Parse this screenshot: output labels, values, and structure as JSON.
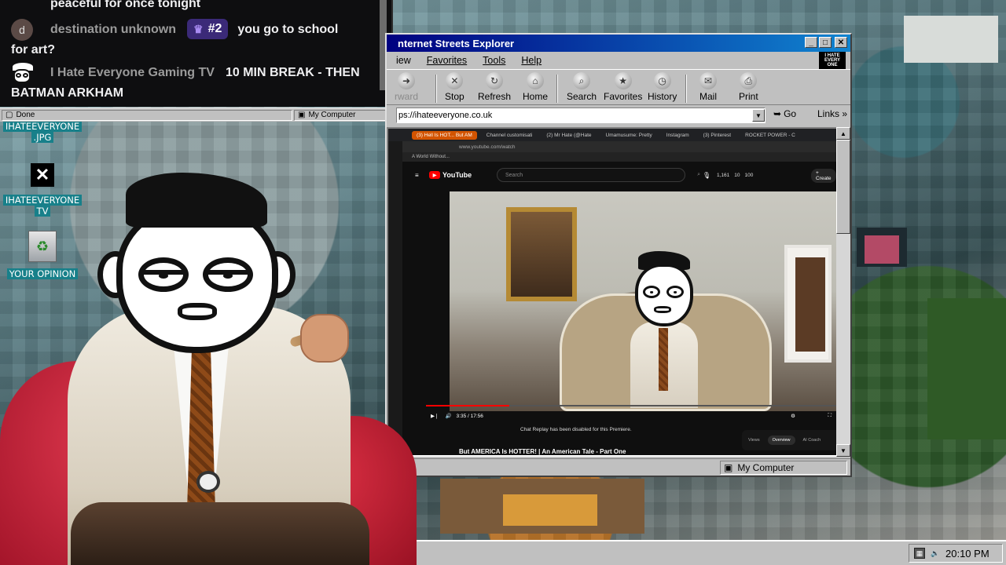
{
  "chat": {
    "partial_line": "peaceful for once tonight",
    "messages": [
      {
        "avatar": "d",
        "user": "destination unknown",
        "badge": "#2",
        "text_1": "you go to school",
        "text_2": "for art?"
      },
      {
        "user": "I Hate Everyone Gaming TV",
        "text_1": "10 MIN BREAK - THEN",
        "text_2": "BATMAN ARKHAM"
      }
    ],
    "status_done": "Done",
    "status_zone": "My Computer"
  },
  "desktop": {
    "icons": [
      {
        "line1": "IHATEEVERYONE",
        "line2": ".JPG"
      },
      {
        "line1": "IHATEEVERYONE",
        "line2": "TV",
        "glyph": "x-logo-icon"
      },
      {
        "line1": "YOUR OPINION",
        "glyph": "recycle-bin-icon"
      }
    ]
  },
  "browser": {
    "title": "nternet Streets Explorer",
    "menu": [
      "iew",
      "Favorites",
      "Tools",
      "Help"
    ],
    "logo_text": "I HATE EVERY ONE",
    "toolbar": [
      {
        "label": "rward",
        "icon": "forward-icon",
        "disabled": true
      },
      {
        "label": "Stop",
        "icon": "stop-icon"
      },
      {
        "label": "Refresh",
        "icon": "refresh-icon"
      },
      {
        "label": "Home",
        "icon": "home-icon"
      },
      {
        "label": "Search",
        "icon": "search-icon"
      },
      {
        "label": "Favorites",
        "icon": "favorites-icon"
      },
      {
        "label": "History",
        "icon": "history-icon"
      },
      {
        "label": "Mail",
        "icon": "mail-icon"
      },
      {
        "label": "Print",
        "icon": "print-icon"
      }
    ],
    "address": "ps://ihateeveryone.co.uk",
    "go": "Go",
    "links": "Links",
    "status_zone": "My Computer"
  },
  "inner": {
    "tabs": [
      "(3) Hell Is HOT... But AM",
      "Channel customisati",
      "(2) Mr Hate (@Hate",
      "Umamusume: Pretty",
      "Instagram",
      "(3) Pinterest",
      "ROCKET POWER - C"
    ],
    "url": "www.youtube.com/watch",
    "bookmark": "A World Without...",
    "youtube": {
      "logo": "YouTube",
      "search_placeholder": "Search",
      "stats": [
        "1,161",
        "10",
        "100"
      ],
      "create": "Create",
      "time": "3:35 / 17:56",
      "progress": 0.2,
      "chat_replay": "Chat Replay has been disabled for this Premiere.",
      "video_title": "But AMERICA Is HOTTER! | An American Tale - Part One",
      "panel_tabs": [
        "Views",
        "Overview",
        "AI Coach"
      ]
    }
  },
  "taskbar": {
    "clock": "20:10 PM"
  }
}
